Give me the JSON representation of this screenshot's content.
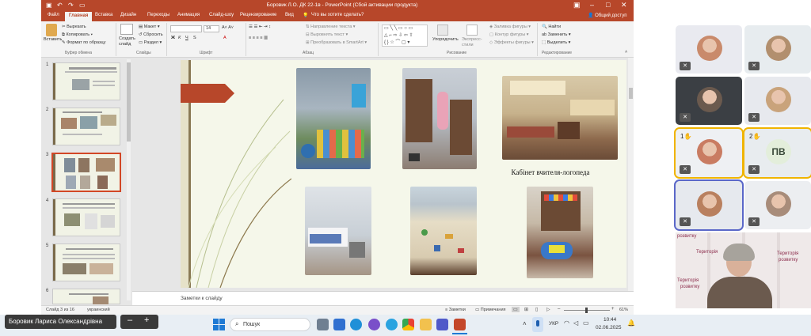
{
  "window": {
    "title": "Боровик Л.О. ДК 22-1в - PowerPoint (Сбой активации продукта)",
    "share_label": "Общий доступ"
  },
  "tabs": [
    "Файл",
    "Главная",
    "Вставка",
    "Дизайн",
    "Переходы",
    "Анимация",
    "Слайд-шоу",
    "Рецензирование",
    "Вид"
  ],
  "tell_me": "Что вы хотите сделать?",
  "ribbon": {
    "paste": "Вставить",
    "cut": "Вырезать",
    "copy": "Копировать",
    "format_painter": "Формат по образцу",
    "clipboard_group": "Буфер обмена",
    "new_slide": "Создать слайд",
    "layout": "Макет",
    "reset": "Сбросить",
    "section": "Раздел",
    "slides_group": "Слайды",
    "font_size": "14",
    "font_group": "Шрифт",
    "text_direction": "Направление текста",
    "align_text": "Выровнять текст",
    "smartart": "Преобразовать в SmartArt",
    "paragraph_group": "Абзац",
    "arrange": "Упорядочить",
    "quick_styles": "Экспресс-стили",
    "shape_fill": "Заливка фигуры",
    "shape_outline": "Контур фигуры",
    "shape_effects": "Эффекты фигуры",
    "drawing_group": "Рисование",
    "find": "Найти",
    "replace": "Заменить",
    "select": "Выделить",
    "editing_group": "Редактирование"
  },
  "thumbnails": [
    "1",
    "2",
    "3",
    "4",
    "5",
    "6"
  ],
  "slide": {
    "caption": "Кабінет вчителя-логопеда"
  },
  "notes_placeholder": "Заметки к слайду",
  "status": {
    "slide_info": "Слайд 3 из 16",
    "language": "украинский",
    "notes": "Заметки",
    "comments": "Примечания",
    "zoom": "61%"
  },
  "participants": [
    {
      "type": "photo",
      "color": "#c98a6b",
      "bg": "#e9eaf0",
      "highlight": ""
    },
    {
      "type": "photo",
      "color": "#b28f6e",
      "bg": "#e7ecef",
      "highlight": ""
    },
    {
      "type": "photo",
      "color": "#6b5a4e",
      "bg": "#3b3f44",
      "highlight": ""
    },
    {
      "type": "photo",
      "color": "#c9a37b",
      "bg": "#e7e9ee",
      "highlight": ""
    },
    {
      "type": "photo",
      "color": "#c97c62",
      "bg": "#eef0f3",
      "highlight": "#f0b400",
      "hand": "1"
    },
    {
      "type": "initials",
      "initials": "ПВ",
      "bg": "#e8ecef",
      "highlight": "#f0b400",
      "hand": "2"
    },
    {
      "type": "photo",
      "color": "#b9805f",
      "bg": "#e6e9ee",
      "highlight": "#5a67c8"
    },
    {
      "type": "photo",
      "color": "#a88c7a",
      "bg": "#eceef1",
      "highlight": ""
    }
  ],
  "speaker_banner": [
    "розвитку",
    "Територія",
    "Територія",
    "розвитку",
    "Територія",
    "розвитку"
  ],
  "name_tag": "Боровик Лариса Олександрівна",
  "taskbar": {
    "search_placeholder": "Пошук",
    "lang": "УКР",
    "time": "10:44",
    "date": "02.06.2025"
  }
}
